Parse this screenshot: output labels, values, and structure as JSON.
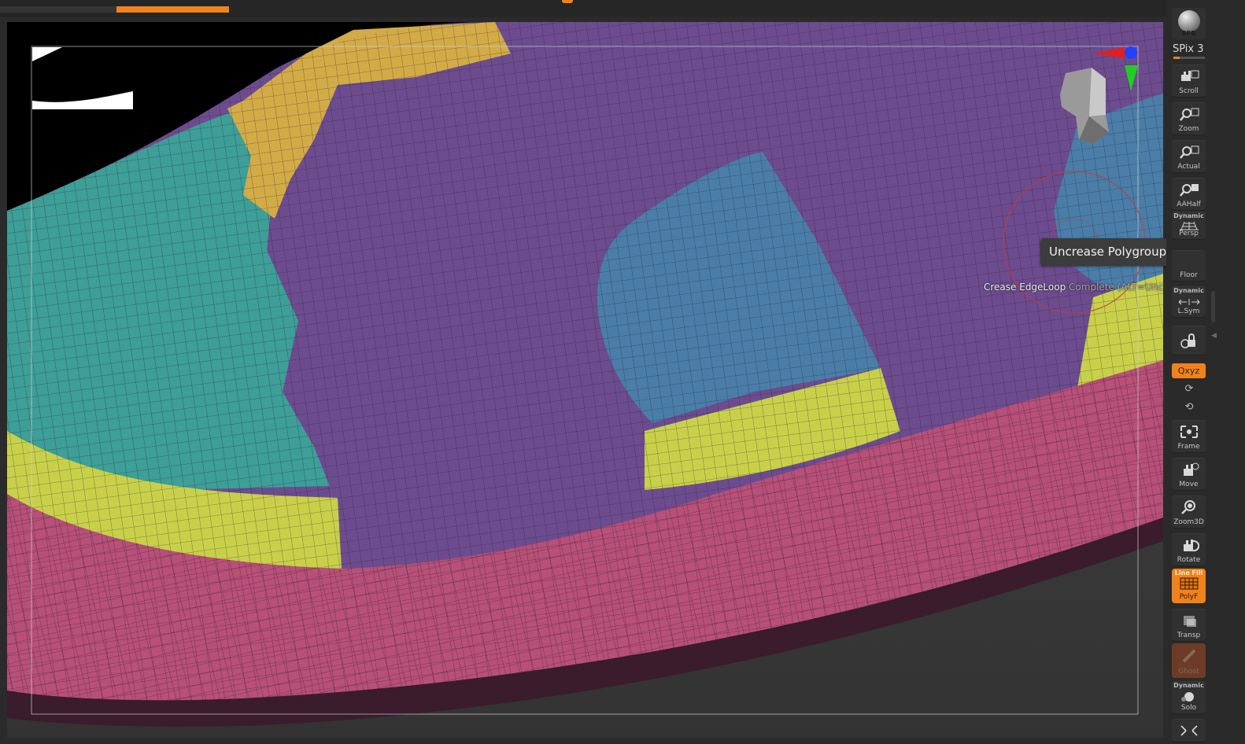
{
  "window": {
    "active_tab_color": "#f0821e"
  },
  "viewport": {
    "tooltip": "Uncrease Polygroups Border",
    "crease_label": "Crease EdgeLoop",
    "crease_hint": " Complete (ALT=Uncreas",
    "polygroup_colors": {
      "purple": "#6c4c8e",
      "teal": "#3e9e98",
      "blue": "#4a7ea8",
      "yellow_green": "#c8d04a",
      "gold": "#d2ab47",
      "pink": "#b85078"
    }
  },
  "toolbar": {
    "bpr": "BPR",
    "spix": "SPix 3",
    "spix_level_fraction": 0.2,
    "scroll": "Scroll",
    "zoom": "Zoom",
    "actual": "Actual",
    "aahalf": "AAHalf",
    "dynamic": "Dynamic",
    "persp": "Persp",
    "floor": "Floor",
    "lsym": "L.Sym",
    "xyz": "Qxyz",
    "frame": "Frame",
    "move": "Move",
    "zoom3d": "Zoom3D",
    "rotate": "Rotate",
    "line_fill": "Line Fill",
    "polyf": "PolyF",
    "transp": "Transp",
    "ghost": "Ghost",
    "solo": "Solo"
  }
}
